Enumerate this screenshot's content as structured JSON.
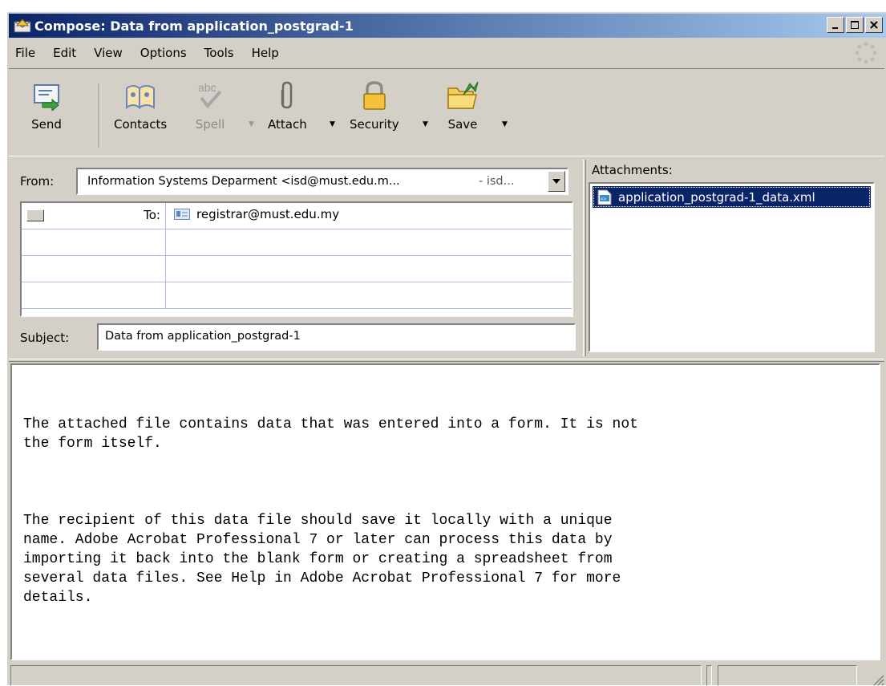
{
  "window": {
    "title": "Compose: Data from application_postgrad-1"
  },
  "menu": [
    "File",
    "Edit",
    "View",
    "Options",
    "Tools",
    "Help"
  ],
  "toolbar": {
    "send": "Send",
    "contacts": "Contacts",
    "spell": "Spell",
    "attach": "Attach",
    "security": "Security",
    "save": "Save"
  },
  "header": {
    "from_label": "From:",
    "from_value": "Information Systems Deparment <isd@must.edu.m...",
    "from_suffix": "- isd...",
    "to_label": "To:",
    "to_value": "registrar@must.edu.my",
    "subject_label": "Subject:",
    "subject_value": "Data from application_postgrad-1"
  },
  "attachments": {
    "label": "Attachments:",
    "items": [
      "application_postgrad-1_data.xml"
    ]
  },
  "message": {
    "paragraphs": [
      "The attached file contains data that was entered into a form. It is not\nthe form itself.",
      "The recipient of this data file should save it locally with a unique\nname. Adobe Acrobat Professional 7 or later can process this data by\nimporting it back into the blank form or creating a spreadsheet from\nseveral data files. See Help in Adobe Acrobat Professional 7 for more\ndetails."
    ]
  }
}
